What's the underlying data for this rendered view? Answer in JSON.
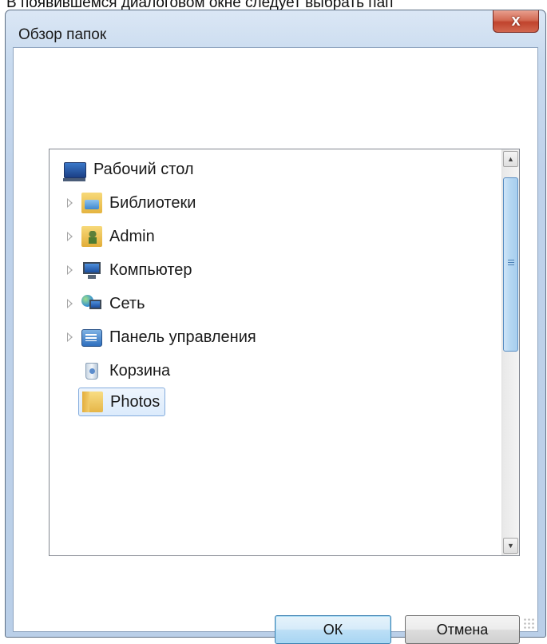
{
  "page_caption": "В появившемся диалоговом окне следует выбрать пап",
  "dialog": {
    "title": "Обзор папок",
    "close_symbol": "x"
  },
  "tree": {
    "items": [
      {
        "label": "Рабочий стол",
        "icon": "desktop-icon",
        "expandable": false,
        "selected": false
      },
      {
        "label": "Библиотеки",
        "icon": "libraries-icon",
        "expandable": true,
        "selected": false
      },
      {
        "label": "Admin",
        "icon": "user-folder-icon",
        "expandable": true,
        "selected": false
      },
      {
        "label": "Компьютер",
        "icon": "computer-icon",
        "expandable": true,
        "selected": false
      },
      {
        "label": "Сеть",
        "icon": "network-icon",
        "expandable": true,
        "selected": false
      },
      {
        "label": "Панель управления",
        "icon": "control-panel-icon",
        "expandable": true,
        "selected": false
      },
      {
        "label": "Корзина",
        "icon": "recycle-bin-icon",
        "expandable": false,
        "selected": false
      },
      {
        "label": "Photos",
        "icon": "folder-icon",
        "expandable": false,
        "selected": true
      }
    ]
  },
  "buttons": {
    "ok": "ОК",
    "cancel": "Отмена"
  },
  "colors": {
    "selection_border": "#84acdd",
    "close_button": "#c0432d",
    "scroll_thumb": "#b3d6f2"
  }
}
